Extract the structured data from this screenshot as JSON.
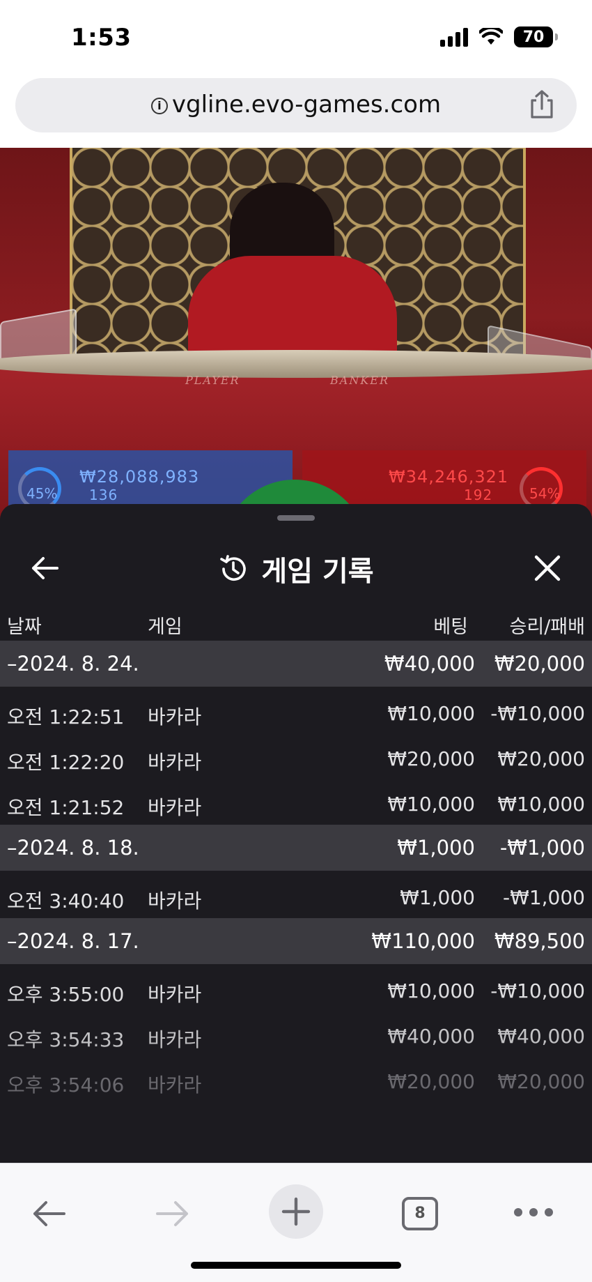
{
  "status_bar": {
    "time": "1:53",
    "battery": "70"
  },
  "browser": {
    "url": "vgline.evo-games.com",
    "tab_count": "8"
  },
  "video": {
    "player_label": "PLAYER",
    "banker_label": "BANKER",
    "player_pct": "45%",
    "player_amount": "₩28,088,983",
    "player_count": "136",
    "banker_pct": "54%",
    "banker_amount": "₩34,246,321",
    "banker_count": "192"
  },
  "sheet": {
    "title": "게임 기록",
    "columns": {
      "date": "날짜",
      "game": "게임",
      "bet": "베팅",
      "win_loss": "승리/패배"
    },
    "groups": [
      {
        "date": "–2024. 8. 24.",
        "bet": "₩40,000",
        "win_loss": "₩20,000",
        "rows": [
          {
            "time": "오전 1:22:51",
            "game": "바카라",
            "bet": "₩10,000",
            "win_loss": "-₩10,000"
          },
          {
            "time": "오전 1:22:20",
            "game": "바카라",
            "bet": "₩20,000",
            "win_loss": "₩20,000"
          },
          {
            "time": "오전 1:21:52",
            "game": "바카라",
            "bet": "₩10,000",
            "win_loss": "₩10,000"
          }
        ]
      },
      {
        "date": "–2024. 8. 18.",
        "bet": "₩1,000",
        "win_loss": "-₩1,000",
        "rows": [
          {
            "time": "오전 3:40:40",
            "game": "바카라",
            "bet": "₩1,000",
            "win_loss": "-₩1,000"
          }
        ]
      },
      {
        "date": "–2024. 8. 17.",
        "bet": "₩110,000",
        "win_loss": "₩89,500",
        "rows": [
          {
            "time": "오후 3:55:00",
            "game": "바카라",
            "bet": "₩10,000",
            "win_loss": "-₩10,000"
          },
          {
            "time": "오후 3:54:33",
            "game": "바카라",
            "bet": "₩40,000",
            "win_loss": "₩40,000"
          },
          {
            "time": "오후 3:54:06",
            "game": "바카라",
            "bet": "₩20,000",
            "win_loss": "₩20,000"
          }
        ]
      }
    ]
  }
}
